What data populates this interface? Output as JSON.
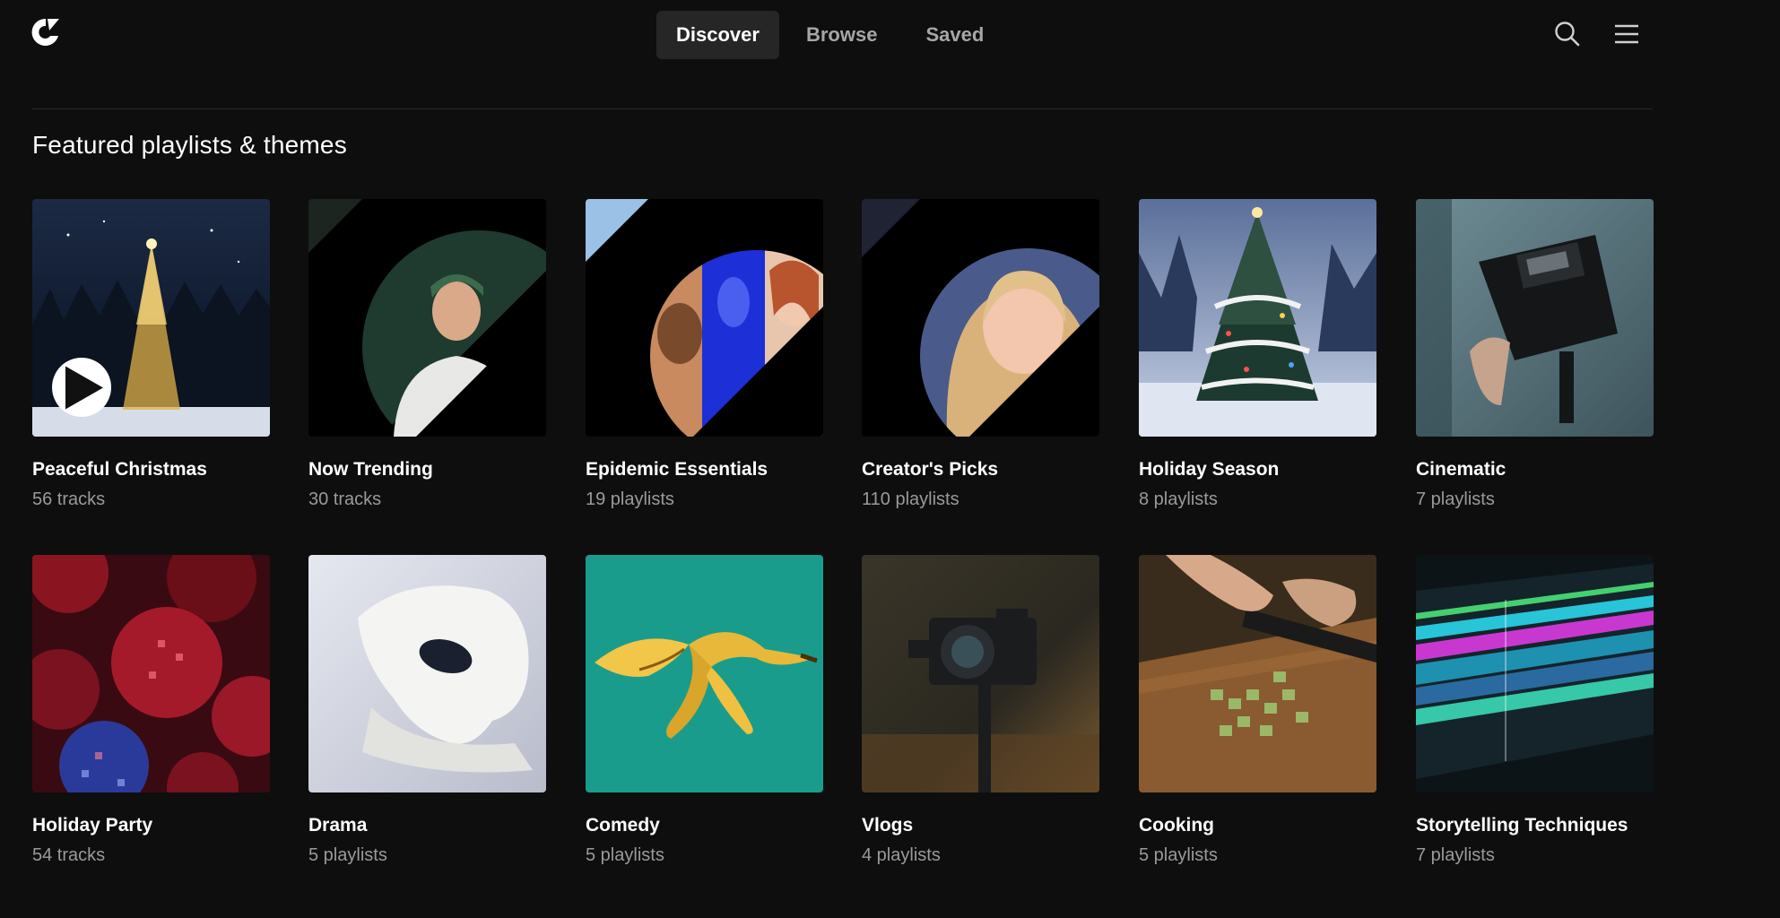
{
  "header": {
    "logo_icon": "brand-logo-icon",
    "tabs": [
      {
        "label": "Discover",
        "active": true
      },
      {
        "label": "Browse",
        "active": false
      },
      {
        "label": "Saved",
        "active": false
      }
    ],
    "search_icon": "search-icon",
    "menu_icon": "hamburger-menu-icon"
  },
  "section": {
    "title": "Featured playlists & themes"
  },
  "cards": [
    {
      "title": "Peaceful Christmas",
      "subtitle": "56 tracks",
      "image": "night-christmas-tree"
    },
    {
      "title": "Now Trending",
      "subtitle": "30 tracks",
      "image": "man-portrait-circle"
    },
    {
      "title": "Epidemic Essentials",
      "subtitle": "19 playlists",
      "image": "three-faces-circle"
    },
    {
      "title": "Creator's Picks",
      "subtitle": "110 playlists",
      "image": "woman-portrait-circle"
    },
    {
      "title": "Holiday Season",
      "subtitle": "8 playlists",
      "image": "snowy-christmas-tree"
    },
    {
      "title": "Cinematic",
      "subtitle": "7 playlists",
      "image": "video-camera"
    },
    {
      "title": "Holiday Party",
      "subtitle": "54 tracks",
      "image": "disco-balls"
    },
    {
      "title": "Drama",
      "subtitle": "5 playlists",
      "image": "white-mask"
    },
    {
      "title": "Comedy",
      "subtitle": "5 playlists",
      "image": "banana-peel"
    },
    {
      "title": "Vlogs",
      "subtitle": "4 playlists",
      "image": "camera-gimbal"
    },
    {
      "title": "Cooking",
      "subtitle": "5 playlists",
      "image": "chopping-herbs"
    },
    {
      "title": "Storytelling Techniques",
      "subtitle": "7 playlists",
      "image": "editing-timeline"
    }
  ],
  "colors": {
    "background": "#0e0e0e",
    "active_tab": "#262626",
    "muted_text": "#9a9a9a"
  }
}
